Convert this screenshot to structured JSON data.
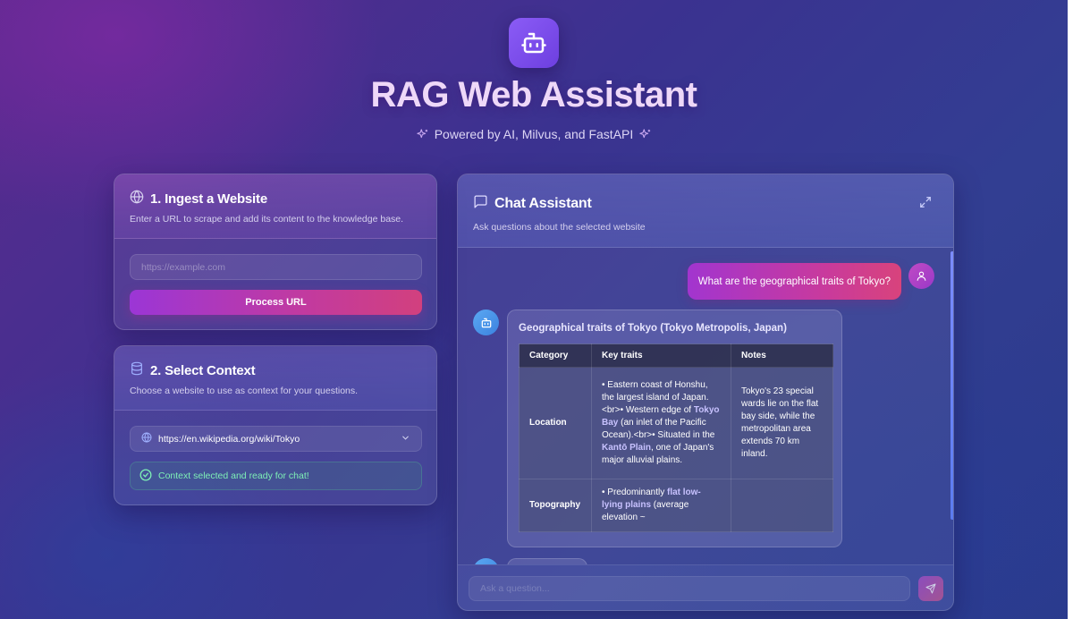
{
  "header": {
    "app_title": "RAG Web Assistant",
    "subtitle": "Powered by AI, Milvus, and FastAPI",
    "logo_icon": "robot-icon",
    "sparkle_icon": "sparkles-icon"
  },
  "ingest": {
    "title": "1. Ingest a Website",
    "description": "Enter a URL to scrape and add its content to the knowledge base.",
    "icon": "globe-icon",
    "url_placeholder": "https://example.com",
    "url_value": "",
    "button_label": "Process URL"
  },
  "context": {
    "title": "2. Select Context",
    "description": "Choose a website to use as context for your questions.",
    "icon": "database-icon",
    "selected_value": "https://en.wikipedia.org/wiki/Tokyo",
    "status_text": "Context selected and ready for chat!",
    "status_color": "#7ef0b6"
  },
  "chat": {
    "title": "Chat Assistant",
    "description": "Ask questions about the selected website",
    "icon": "message-square-icon",
    "expand_icon": "expand-icon",
    "input_placeholder": "Ask a question...",
    "input_value": "",
    "send_icon": "send-icon",
    "messages": [
      {
        "role": "user",
        "text": "What are the geographical traits of Tokyo?"
      },
      {
        "role": "assistant",
        "heading": "Geographical traits of Tokyo (Tokyo Metropolis, Japan)",
        "table": {
          "headers": [
            "Category",
            "Key traits",
            "Notes"
          ],
          "rows": [
            {
              "category": "Location",
              "traits": {
                "part1": "• Eastern coast of Honshu, the largest island of Japan. <br>• Western edge of ",
                "hl1": "Tokyo Bay",
                "part2": " (an inlet of the Pacific Ocean).<br>• Situated in the ",
                "hl2": "Kantō Plain",
                "part3": ", one of Japan's major alluvial plains."
              },
              "notes": "Tokyo's 23 special wards lie on the flat bay side, while the metropolitan area extends 70 km inland."
            },
            {
              "category": "Topography",
              "traits": {
                "part1": "• Predominantly ",
                "hl1": "flat low-lying plains",
                "part2": " (average elevation ~"
              },
              "notes": ""
            }
          ]
        }
      }
    ]
  },
  "colors": {
    "accent_gradient_start": "#9b36d6",
    "accent_gradient_end": "#d2407e",
    "bot_avatar": "#3b82e0"
  }
}
